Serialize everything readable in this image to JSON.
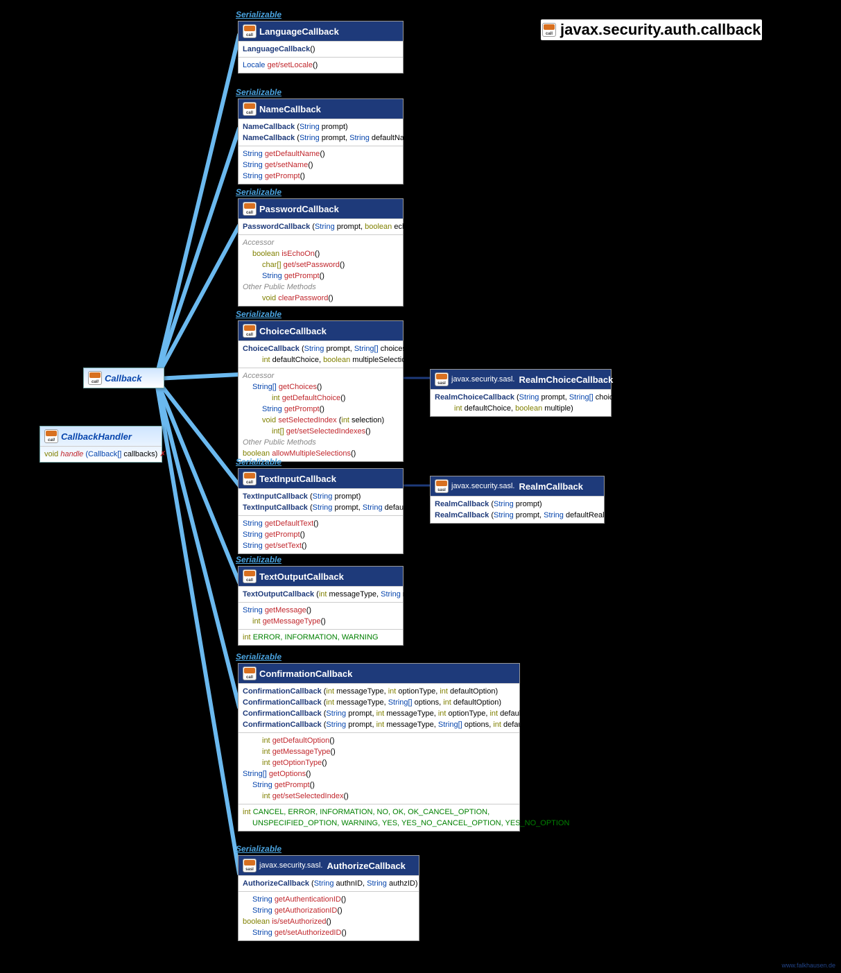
{
  "title": {
    "package": "javax.security.auth.callback"
  },
  "serializable": "Serializable",
  "callback": {
    "name": "Callback"
  },
  "callbackHandler": {
    "name": "CallbackHandler",
    "retType": "void",
    "method": "handle",
    "params": "(Callback[] callbacks)",
    "throws": "✗"
  },
  "languageCallback": {
    "name": "LanguageCallback",
    "ctor": "LanguageCallback",
    "ctorP": "()",
    "r1t": "Locale",
    "r1m": "get/",
    "r1m2": "setLocale",
    "r1p": "()"
  },
  "nameCallback": {
    "name": "NameCallback",
    "c1": "NameCallback",
    "c1p": "(String prompt)",
    "c2": "NameCallback",
    "c2p": "(String prompt, String defaultName)",
    "r1t": "String",
    "r1m": "getDefaultName",
    "r1p": "()",
    "r2t": "String",
    "r2m": "get/",
    "r2m2": "setName",
    "r2p": "()",
    "r3t": "String",
    "r3m": "getPrompt",
    "r3p": "()"
  },
  "passwordCallback": {
    "name": "PasswordCallback",
    "c1": "PasswordCallback",
    "c1p": "(String prompt, boolean echoOn)",
    "acc": "Accessor",
    "r1t": "boolean",
    "r1m": "isEchoOn",
    "r1p": "()",
    "r2t": "char[]",
    "r2m": "get/",
    "r2m2": "setPassword",
    "r2p": "()",
    "r3t": "String",
    "r3m": "getPrompt",
    "r3p": "()",
    "other": "Other Public Methods",
    "r4t": "void",
    "r4m": "clearPassword",
    "r4p": "()"
  },
  "choiceCallback": {
    "name": "ChoiceCallback",
    "c1": "ChoiceCallback",
    "c1p": "(String prompt, String[] choices,",
    "c1p2": "int defaultChoice, boolean multipleSelectionsAllowed)",
    "acc": "Accessor",
    "r1t": "String[]",
    "r1m": "getChoices",
    "r1p": "()",
    "r2t": "int",
    "r2m": "getDefaultChoice",
    "r2p": "()",
    "r3t": "String",
    "r3m": "getPrompt",
    "r3p": "()",
    "r4t": "void",
    "r4m": "setSelectedIndex",
    "r4p": "(int selection)",
    "r5t": "int[]",
    "r5m": "get/",
    "r5m2": "setSelectedIndexes",
    "r5p": "()",
    "other": "Other Public Methods",
    "r6t": "boolean",
    "r6m": "allowMultipleSelections",
    "r6p": "()"
  },
  "realmChoiceCallback": {
    "pkg": "javax.security.sasl.",
    "name": "RealmChoiceCallback",
    "c1": "RealmChoiceCallback",
    "c1p": "(String prompt, String[] choices,",
    "c1p2": "int defaultChoice, boolean multiple)"
  },
  "textInputCallback": {
    "name": "TextInputCallback",
    "c1": "TextInputCallback",
    "c1p": "(String prompt)",
    "c2": "TextInputCallback",
    "c2p": "(String prompt, String defaultText)",
    "r1t": "String",
    "r1m": "getDefaultText",
    "r1p": "()",
    "r2t": "String",
    "r2m": "getPrompt",
    "r2p": "()",
    "r3t": "String",
    "r3m": "get/",
    "r3m2": "setText",
    "r3p": "()"
  },
  "realmCallback": {
    "pkg": "javax.security.sasl.",
    "name": "RealmCallback",
    "c1": "RealmCallback",
    "c1p": "(String prompt)",
    "c2": "RealmCallback",
    "c2p": "(String prompt, String defaultRealmInfo)"
  },
  "textOutputCallback": {
    "name": "TextOutputCallback",
    "c1": "TextOutputCallback",
    "c1p": "(int messageType, String message)",
    "r1t": "String",
    "r1m": "getMessage",
    "r1p": "()",
    "r2t": "int",
    "r2m": "getMessageType",
    "r2p": "()",
    "constT": "int",
    "constV": "ERROR, INFORMATION, WARNING"
  },
  "confirmationCallback": {
    "name": "ConfirmationCallback",
    "c1": "ConfirmationCallback",
    "c1p": "(int messageType, int optionType, int defaultOption)",
    "c2": "ConfirmationCallback",
    "c2p": "(int messageType, String[] options, int defaultOption)",
    "c3": "ConfirmationCallback",
    "c3p": "(String prompt, int messageType, int optionType, int defaultOption)",
    "c4": "ConfirmationCallback",
    "c4p": "(String prompt, int messageType, String[] options, int defaultOption)",
    "r1t": "int",
    "r1m": "getDefaultOption",
    "r1p": "()",
    "r2t": "int",
    "r2m": "getMessageType",
    "r2p": "()",
    "r3t": "int",
    "r3m": "getOptionType",
    "r3p": "()",
    "r4t": "String[]",
    "r4m": "getOptions",
    "r4p": "()",
    "r5t": "String",
    "r5m": "getPrompt",
    "r5p": "()",
    "r6t": "int",
    "r6m": "get/",
    "r6m2": "setSelectedIndex",
    "r6p": "()",
    "constT": "int",
    "constV": "CANCEL, ERROR, INFORMATION, NO, OK, OK_CANCEL_OPTION,",
    "constV2": "UNSPECIFIED_OPTION, WARNING, YES, YES_NO_CANCEL_OPTION, YES_NO_OPTION"
  },
  "authorizeCallback": {
    "pkg": "javax.security.sasl.",
    "name": "AuthorizeCallback",
    "c1": "AuthorizeCallback",
    "c1p": "(String authnID, String authzID)",
    "r1t": "String",
    "r1m": "getAuthenticationID",
    "r1p": "()",
    "r2t": "String",
    "r2m": "getAuthorizationID",
    "r2p": "()",
    "r3t": "boolean",
    "r3m": "is/",
    "r3m2": "setAuthorized",
    "r3p": "()",
    "r4t": "String",
    "r4m": "get/",
    "r4m2": "setAuthorizedID",
    "r4p": "()"
  },
  "credit": "www.falkhausen.de"
}
